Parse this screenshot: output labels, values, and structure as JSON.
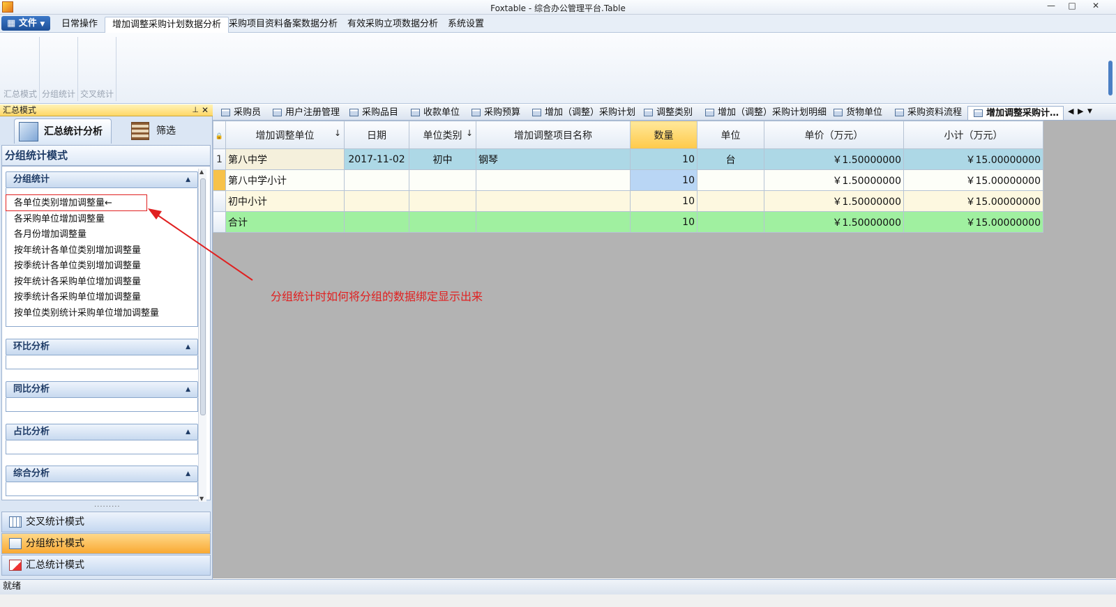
{
  "window": {
    "title": "Foxtable - 综合办公管理平台.Table",
    "min": "—",
    "max": "□",
    "close": "✕"
  },
  "menu": {
    "file_label": "文件",
    "tabs": [
      "日常操作",
      "增加调整采购计划数据分析",
      "采购项目资料备案数据分析",
      "有效采购立项数据分析",
      "系统设置"
    ],
    "active_tab": "增加调整采购计划数据分析"
  },
  "ribbon": {
    "groups": [
      "汇总模式",
      "分组统计",
      "交叉统计"
    ]
  },
  "left_panel": {
    "header": "汇总模式",
    "pin": "⊥",
    "close": "✕",
    "top_tabs": [
      "汇总统计分析",
      "筛选"
    ],
    "title": "分组统计模式",
    "groups": [
      {
        "label": "分组统计",
        "items": [
          "各单位类别增加调整量←",
          "各采购单位增加调整量",
          "各月份增加调整量",
          "按年统计各单位类别增加调整量",
          "按季统计各单位类别增加调整量",
          "按年统计各采购单位增加调整量",
          "按季统计各采购单位增加调整量",
          "按单位类别统计采购单位增加调整量"
        ]
      },
      {
        "label": "环比分析",
        "items": []
      },
      {
        "label": "同比分析",
        "items": []
      },
      {
        "label": "占比分析",
        "items": []
      },
      {
        "label": "综合分析",
        "items": []
      }
    ],
    "nav_buttons": [
      "交叉统计模式",
      "分组统计模式",
      "汇总统计模式"
    ],
    "active_nav": "分组统计模式"
  },
  "doc_tabs": [
    "采购员",
    "用户注册管理",
    "采购品目",
    "收款单位",
    "采购预算",
    "增加（调整）采购计划",
    "调整类别",
    "增加（调整）采购计划明细",
    "货物单位",
    "采购资料流程",
    "增加调整采购计…"
  ],
  "active_doc_tab": "增加调整采购计…",
  "grid": {
    "columns": [
      "增加调整单位",
      "日期",
      "单位类别",
      "增加调整项目名称",
      "数量",
      "单位",
      "单价（万元）",
      "小计（万元）"
    ],
    "rows": [
      {
        "rownum": "1",
        "cells": [
          "第八中学",
          "2017-11-02",
          "初中",
          "钢琴",
          "10",
          "台",
          "￥1.50000000",
          "￥15.00000000"
        ]
      },
      {
        "rownum": "",
        "cells": [
          "第八中学小计",
          "",
          "",
          "",
          "10",
          "",
          "￥1.50000000",
          "￥15.00000000"
        ]
      },
      {
        "rownum": "",
        "cells": [
          "初中小计",
          "",
          "",
          "",
          "10",
          "",
          "￥1.50000000",
          "￥15.00000000"
        ]
      },
      {
        "rownum": "",
        "cells": [
          "合计",
          "",
          "",
          "",
          "10",
          "",
          "￥1.50000000",
          "￥15.00000000"
        ]
      }
    ]
  },
  "annotation": "分组统计时如何将分组的数据绑定显示出来",
  "status": "就绪",
  "colors": {
    "subtotal_row": "#a0f0a0",
    "highlight_header": "#ffc94a",
    "annotation": "#e02020"
  }
}
